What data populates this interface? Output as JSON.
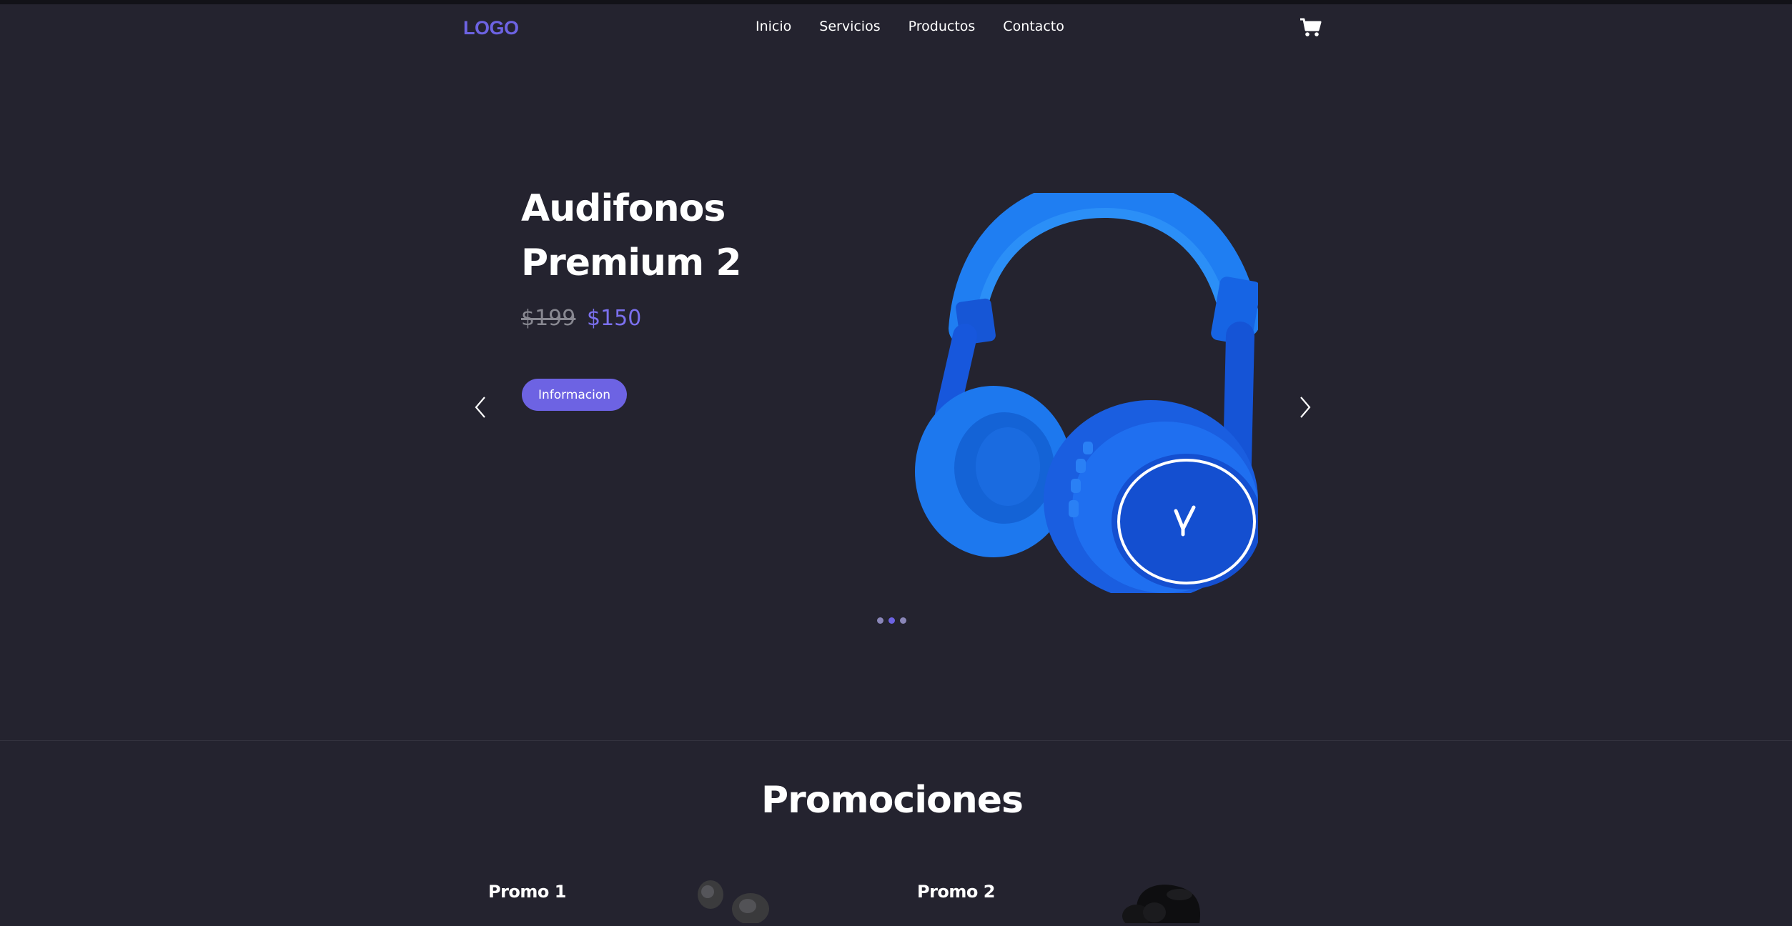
{
  "nav": {
    "logo": "LOGO",
    "links": [
      "Inicio",
      "Servicios",
      "Productos",
      "Contacto"
    ],
    "cart_icon": "cart-icon"
  },
  "hero": {
    "title": "Audifonos Premium 2",
    "price_old": "$199",
    "price_new": "$150",
    "button_label": "Informacion",
    "image": "blue-headphones",
    "prev_icon": "chevron-left-icon",
    "next_icon": "chevron-right-icon",
    "slides_total": 3,
    "slide_active": 2
  },
  "promotions": {
    "title": "Promociones",
    "cards": [
      {
        "label": "Promo 1",
        "image": "earbuds-gray"
      },
      {
        "label": "Promo 2",
        "image": "earbuds-black"
      }
    ]
  },
  "colors": {
    "background": "#24232f",
    "accent": "#6d63e3",
    "headphone_blue": "#1e6ff0"
  }
}
